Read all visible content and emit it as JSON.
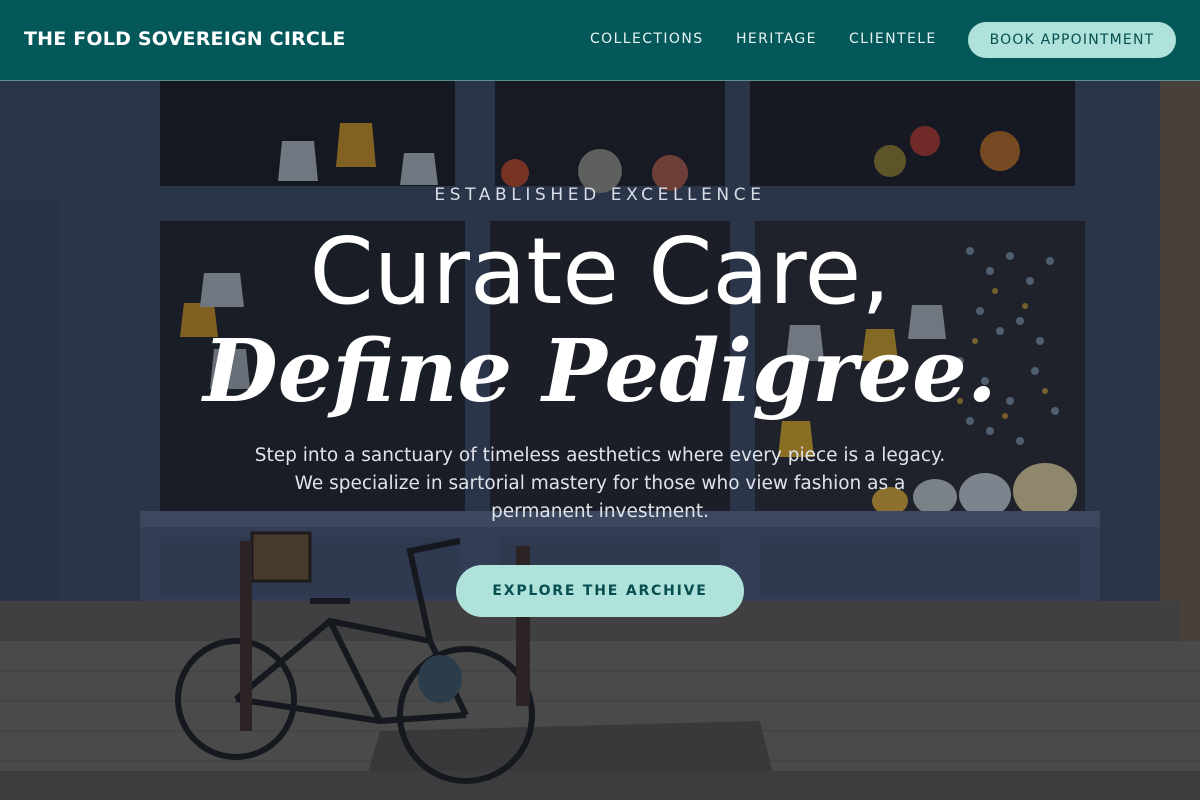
{
  "header": {
    "brand": "THE FOLD SOVEREIGN CIRCLE",
    "nav": [
      {
        "label": "COLLECTIONS"
      },
      {
        "label": "HERITAGE"
      },
      {
        "label": "CLIENTELE"
      }
    ],
    "book_label": "BOOK APPOINTMENT"
  },
  "hero": {
    "eyebrow": "ESTABLISHED EXCELLENCE",
    "headline_line1": "Curate Care,",
    "headline_line2": "Define Pedigree.",
    "lede": "Step into a sanctuary of timeless aesthetics where every piece is a legacy. We specialize in sartorial mastery for those who view fashion as a permanent investment.",
    "cta_label": "EXPLORE THE ARCHIVE",
    "background_description": "storefront-with-bicycle-photo"
  },
  "colors": {
    "header_bg": "#04585a",
    "accent_button": "#aee2da",
    "accent_text": "#074f50"
  }
}
